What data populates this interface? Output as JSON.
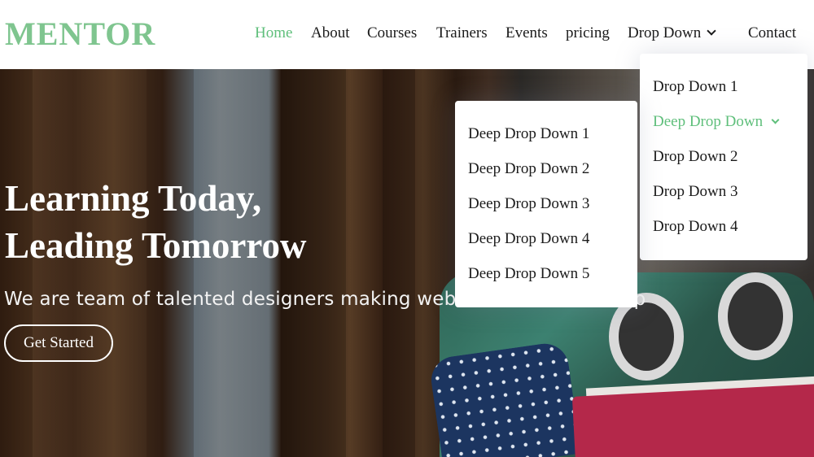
{
  "brand": {
    "logo": "MENTOR",
    "accent_color": "#5fbf7b"
  },
  "nav": {
    "items": [
      {
        "label": "Home",
        "active": true
      },
      {
        "label": "About"
      },
      {
        "label": "Courses"
      },
      {
        "label": "Trainers"
      },
      {
        "label": "Events"
      },
      {
        "label": "pricing"
      },
      {
        "label": "Drop Down",
        "icon": "chevron-down-icon"
      },
      {
        "label": "Contact"
      }
    ]
  },
  "dropdown": {
    "items": [
      {
        "label": "Drop Down 1"
      },
      {
        "label": "Deep Drop Down",
        "active": true,
        "icon": "chevron-down-icon"
      },
      {
        "label": "Drop Down 2"
      },
      {
        "label": "Drop Down 3"
      },
      {
        "label": "Drop Down 4"
      }
    ]
  },
  "deep_dropdown": {
    "items": [
      {
        "label": "Deep Drop Down 1"
      },
      {
        "label": "Deep Drop Down 2"
      },
      {
        "label": "Deep Drop Down 3"
      },
      {
        "label": "Deep Drop Down 4"
      },
      {
        "label": "Deep Drop Down 5"
      }
    ]
  },
  "hero": {
    "title_line1": "Learning Today,",
    "title_line2": "Leading Tomorrow",
    "subtitle": "We are team of talented designers making websites with Bootstrap",
    "cta_label": "Get Started"
  }
}
